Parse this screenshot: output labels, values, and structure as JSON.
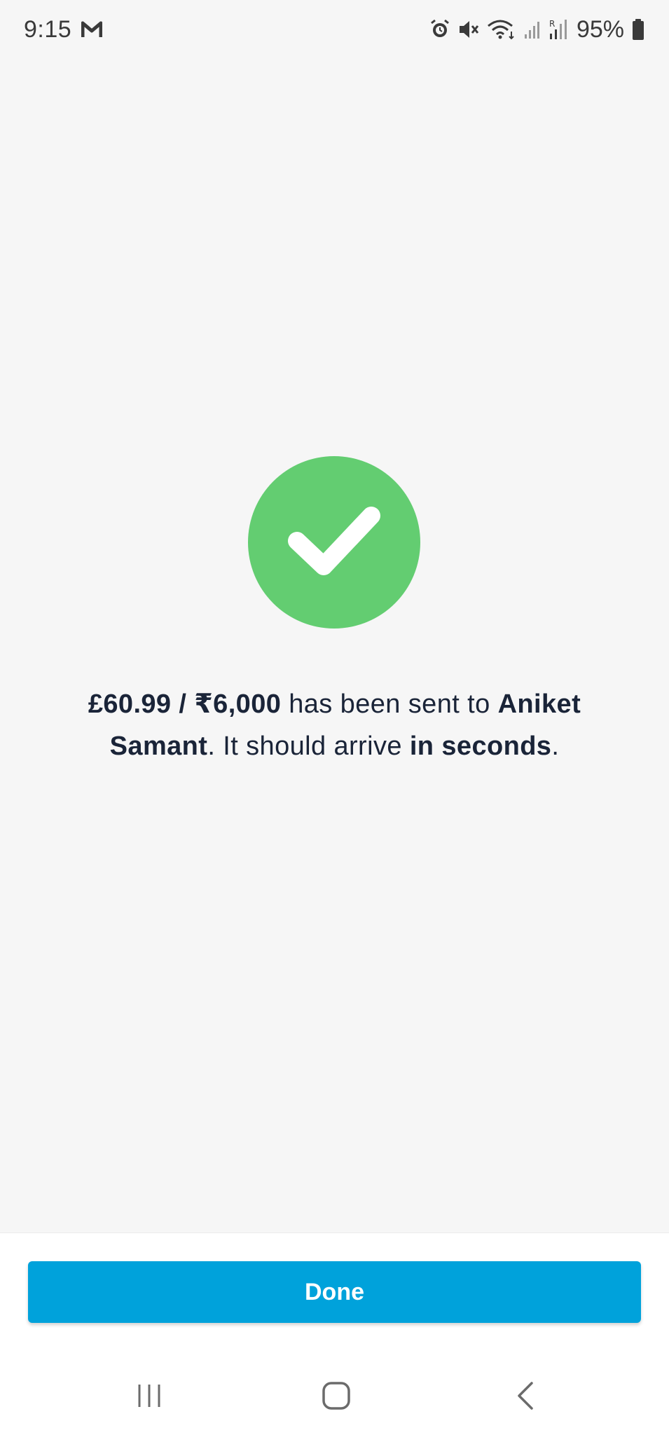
{
  "status_bar": {
    "time": "9:15",
    "app_icon": "gmail-m-icon",
    "icons": [
      "alarm-icon",
      "mute-icon",
      "wifi-icon",
      "signal-icon",
      "roaming-signal-icon",
      "battery-icon"
    ],
    "battery_percent": "95%"
  },
  "success": {
    "icon": "check-icon",
    "icon_color": "#63cd71",
    "amount": "£60.99 / ₹6,000",
    "text_sent": " has been sent to ",
    "recipient_first": "Aniket",
    "recipient_last": "Samant",
    "text_arrive": ". It should arrive ",
    "timing": "in seconds",
    "end": "."
  },
  "actions": {
    "done_label": "Done",
    "button_color": "#00a2db"
  },
  "nav": {
    "icons": [
      "recent-apps-icon",
      "home-icon",
      "back-icon"
    ]
  }
}
